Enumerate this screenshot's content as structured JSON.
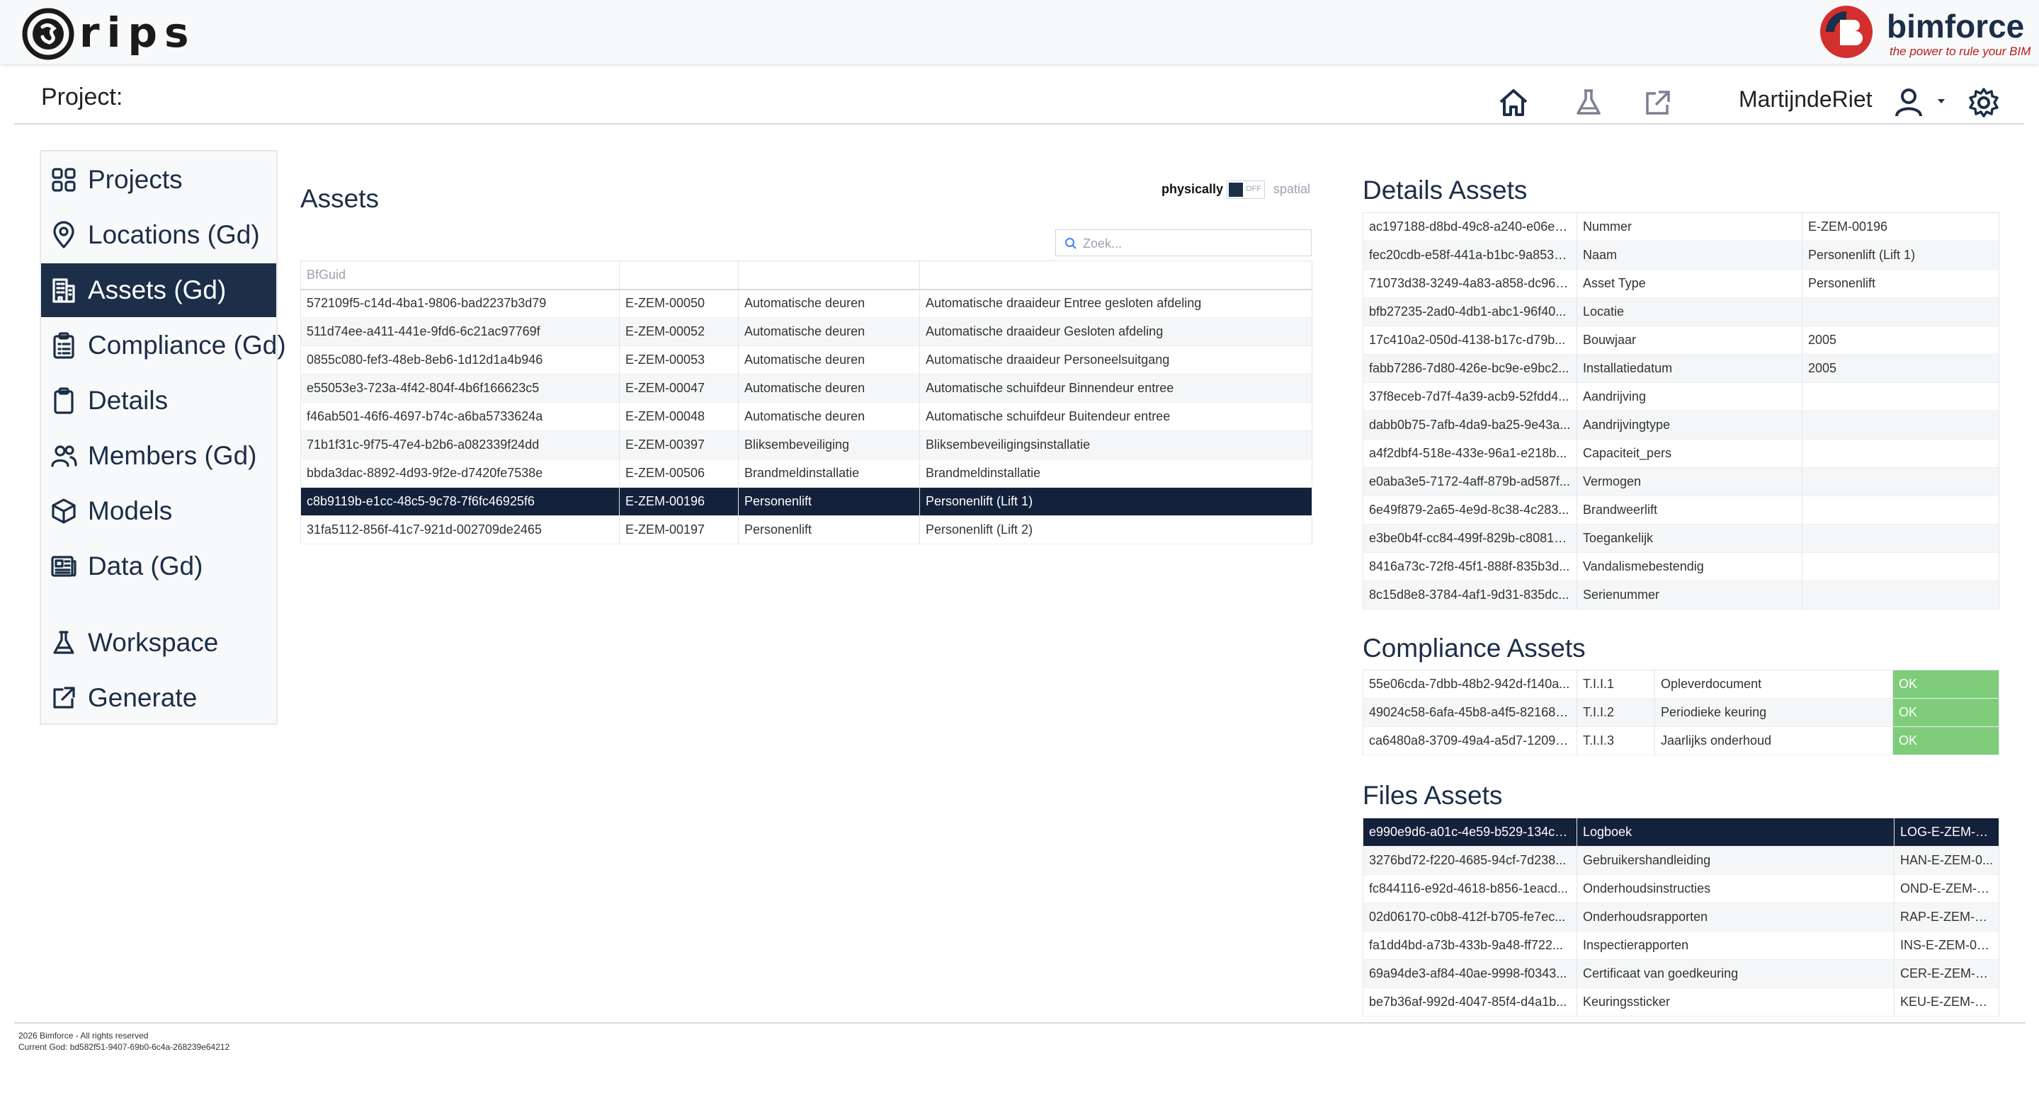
{
  "brand": {
    "logo_text": "rips",
    "partner_name": "bimforce",
    "partner_tagline": "the power to rule your BIM"
  },
  "header": {
    "project_label": "Project:",
    "username": "MartijndeRiet"
  },
  "colors": {
    "primary": "#1c2e48",
    "selected_row": "#13213b",
    "ok": "#7fcd7b",
    "brand_red": "#d32f2f"
  },
  "sidebar": {
    "items": [
      {
        "label": "Projects",
        "icon": "grid-icon"
      },
      {
        "label": "Locations (Gd)",
        "icon": "map-pin-icon"
      },
      {
        "label": "Assets (Gd)",
        "icon": "building-icon",
        "active": true
      },
      {
        "label": "Compliance (Gd)",
        "icon": "clipboard-list-icon"
      },
      {
        "label": "Details",
        "icon": "clipboard-icon"
      },
      {
        "label": "Members (Gd)",
        "icon": "users-icon"
      },
      {
        "label": "Models",
        "icon": "cube-icon"
      },
      {
        "label": "Data (Gd)",
        "icon": "newspaper-icon"
      },
      {
        "label": "Workspace",
        "icon": "flask-icon"
      },
      {
        "label": "Generate",
        "icon": "external-link-icon"
      }
    ]
  },
  "assets": {
    "title": "Assets",
    "toggle": {
      "left_label": "physically",
      "state": "OFF",
      "right_label": "spatial"
    },
    "search_placeholder": "Zoek...",
    "column_header": "BfGuid",
    "rows": [
      [
        "572109f5-c14d-4ba1-9806-bad2237b3d79",
        "E-ZEM-00050",
        "Automatische deuren",
        "Automatische draaideur Entree gesloten afdeling"
      ],
      [
        "511d74ee-a411-441e-9fd6-6c21ac97769f",
        "E-ZEM-00052",
        "Automatische deuren",
        "Automatische draaideur Gesloten afdeling"
      ],
      [
        "0855c080-fef3-48eb-8eb6-1d12d1a4b946",
        "E-ZEM-00053",
        "Automatische deuren",
        "Automatische draaideur Personeelsuitgang"
      ],
      [
        "e55053e3-723a-4f42-804f-4b6f166623c5",
        "E-ZEM-00047",
        "Automatische deuren",
        "Automatische schuifdeur Binnendeur entree"
      ],
      [
        "f46ab501-46f6-4697-b74c-a6ba5733624a",
        "E-ZEM-00048",
        "Automatische deuren",
        "Automatische schuifdeur Buitendeur entree"
      ],
      [
        "71b1f31c-9f75-47e4-b2b6-a082339f24dd",
        "E-ZEM-00397",
        "Bliksembeveiliging",
        "Bliksembeveiligingsinstallatie"
      ],
      [
        "bbda3dac-8892-4d93-9f2e-d7420fe7538e",
        "E-ZEM-00506",
        "Brandmeldinstallatie",
        "Brandmeldinstallatie"
      ],
      [
        "c8b9119b-e1cc-48c5-9c78-7f6fc46925f6",
        "E-ZEM-00196",
        "Personenlift",
        "Personenlift (Lift 1)"
      ],
      [
        "31fa5112-856f-41c7-921d-002709de2465",
        "E-ZEM-00197",
        "Personenlift",
        "Personenlift (Lift 2)"
      ]
    ],
    "selected_index": 7
  },
  "details": {
    "title": "Details Assets",
    "rows": [
      [
        "ac197188-d8bd-49c8-a240-e06e8...",
        "Nummer",
        "E-ZEM-00196"
      ],
      [
        "fec20cdb-e58f-441a-b1bc-9a8536...",
        "Naam",
        "Personenlift (Lift 1)"
      ],
      [
        "71073d38-3249-4a83-a858-dc966...",
        "Asset Type",
        "Personenlift"
      ],
      [
        "bfb27235-2ad0-4db1-abc1-96f40...",
        "Locatie",
        ""
      ],
      [
        "17c410a2-050d-4138-b17c-d79b...",
        "Bouwjaar",
        "2005"
      ],
      [
        "fabb7286-7d80-426e-bc9e-e9bc2...",
        "Installatiedatum",
        "2005"
      ],
      [
        "37f8eceb-7d7f-4a39-acb9-52fdd4...",
        "Aandrijving",
        ""
      ],
      [
        "dabb0b75-7afb-4da9-ba25-9e43a...",
        "Aandrijvingtype",
        ""
      ],
      [
        "a4f2dbf4-518e-433e-96a1-e218b...",
        "Capaciteit_pers",
        ""
      ],
      [
        "e0aba3e5-7172-4aff-879b-ad587f...",
        "Vermogen",
        ""
      ],
      [
        "6e49f879-2a65-4e9d-8c38-4c283...",
        "Brandweerlift",
        ""
      ],
      [
        "e3be0b4f-cc84-499f-829b-c80819...",
        "Toegankelijk",
        ""
      ],
      [
        "8416a73c-72f8-45f1-888f-835b3d...",
        "Vandalismebestendig",
        ""
      ],
      [
        "8c15d8e8-3784-4af1-9d31-835dc...",
        "Serienummer",
        ""
      ]
    ]
  },
  "compliance": {
    "title": "Compliance Assets",
    "rows": [
      [
        "55e06cda-7dbb-48b2-942d-f140a...",
        "T.I.I.1",
        "Opleverdocument",
        "OK"
      ],
      [
        "49024c58-6afa-45b8-a4f5-821680...",
        "T.I.I.2",
        "Periodieke keuring",
        "OK"
      ],
      [
        "ca6480a8-3709-49a4-a5d7-12093...",
        "T.I.I.3",
        "Jaarlijks onderhoud",
        "OK"
      ]
    ]
  },
  "files": {
    "title": "Files Assets",
    "rows": [
      [
        "e990e9d6-a01c-4e59-b529-134cb...",
        "Logboek",
        "LOG-E-ZEM-00..."
      ],
      [
        "3276bd72-f220-4685-94cf-7d238...",
        "Gebruikershandleiding",
        "HAN-E-ZEM-0..."
      ],
      [
        "fc844116-e92d-4618-b856-1eacd...",
        "Onderhoudsinstructies",
        "OND-E-ZEM-0..."
      ],
      [
        "02d06170-c0b8-412f-b705-fe7ec...",
        "Onderhoudsrapporten",
        "RAP-E-ZEM-00..."
      ],
      [
        "fa1dd4bd-a73b-433b-9a48-ff722...",
        "Inspectierapporten",
        "INS-E-ZEM-00..."
      ],
      [
        "69a94de3-af84-40ae-9998-f0343...",
        "Certificaat van goedkeuring",
        "CER-E-ZEM-00..."
      ],
      [
        "be7b36af-992d-4047-85f4-d4a1b...",
        "Keuringssticker",
        "KEU-E-ZEM-00..."
      ]
    ],
    "selected_index": 0
  },
  "footer": {
    "copyright": "2026 Bimforce - All rights reserved",
    "current_god": "Current God: bd582f51-9407-69b0-6c4a-268239e64212"
  }
}
